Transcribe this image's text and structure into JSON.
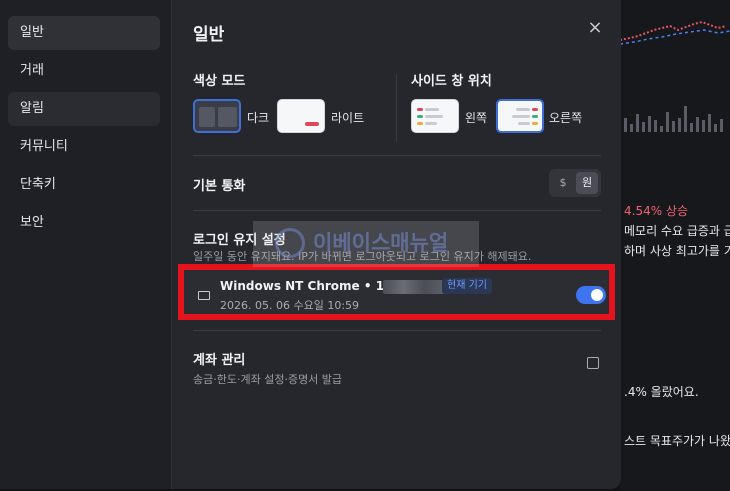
{
  "sidebar": {
    "items": [
      {
        "label": "일반"
      },
      {
        "label": "거래"
      },
      {
        "label": "알림"
      },
      {
        "label": "커뮤니티"
      },
      {
        "label": "단축키"
      },
      {
        "label": "보안"
      }
    ]
  },
  "header": {
    "title": "일반",
    "close_icon": "×"
  },
  "color_mode": {
    "label": "색상 모드",
    "options": [
      {
        "label": "다크",
        "selected": true
      },
      {
        "label": "라이트",
        "selected": false
      }
    ]
  },
  "side_panel": {
    "label": "사이드 창 위치",
    "options": [
      {
        "label": "왼쪽",
        "selected": false
      },
      {
        "label": "오른쪽",
        "selected": true
      }
    ]
  },
  "currency": {
    "label": "기본 통화",
    "options": [
      "$",
      "원"
    ],
    "selected": "원"
  },
  "login_keep": {
    "label": "로그인 유지 설정",
    "description": "일주일 동안 유지돼요. IP가 바뀌면 로그아웃되고 로그인 유지가 해제돼요.",
    "device": {
      "name": "Windows NT Chrome • 12",
      "badge": "현재 기기",
      "datetime": "2026. 05. 06 수요일 10:59",
      "toggle_on": true
    }
  },
  "account": {
    "label": "계좌 관리",
    "description": "송금·한도·계좌 설정·증명서 발급"
  },
  "watermark": {
    "text": "이베이스매뉴얼"
  },
  "background": {
    "pct": "4.54% 상승",
    "line1": "메모리 수요 급증과 급",
    "line2": "하며 사상 최고가를 기록",
    "line3": ".4% 올랐어요.",
    "line4": "스트 목표주가가 나왔어"
  },
  "colors": {
    "accent": "#3f74f0",
    "highlight_box": "#e5141c",
    "rise": "#f0616d"
  }
}
